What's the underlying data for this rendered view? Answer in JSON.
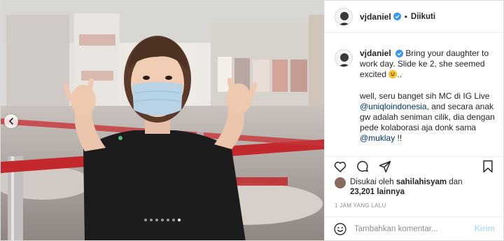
{
  "post": {
    "username": "vjdaniel",
    "follow_status": "Diikuti",
    "separator": "•",
    "caption": {
      "username": "vjdaniel",
      "line1": "Bring your daughter to work day. Slide ke 2, she seemed excited",
      "line1_tail": "..",
      "para2_a": "well, seru banget sih MC di IG Live",
      "mention1": "@uniqloindonesia",
      "para2_b": ", and secara anak gw adalah seniman cilik, dia dengan pede kolaborasi aja donk sama",
      "mention2": "@muklay",
      "para2_c": " !!"
    },
    "likes": {
      "prefix": "Disukai oleh",
      "liker": "sahilahisyam",
      "mid": "dan",
      "count": "23,201 lainnya"
    },
    "timestamp": "1 JAM YANG LALU",
    "comment": {
      "placeholder": "Tambahkan komentar...",
      "post_label": "Kirim"
    }
  },
  "carousel": {
    "slide_count": 7,
    "active_index": 6
  },
  "icons": {
    "verified": "verified-badge-icon",
    "like": "heart-icon",
    "comment": "comment-icon",
    "share": "paper-plane-icon",
    "save": "bookmark-icon",
    "emoji": "smiley-icon",
    "prev": "chevron-left-icon"
  },
  "colors": {
    "verified_blue": "#3897f0",
    "post_button": "#b2dffc",
    "mention": "#00376b",
    "timestamp": "#8e8e8e"
  }
}
